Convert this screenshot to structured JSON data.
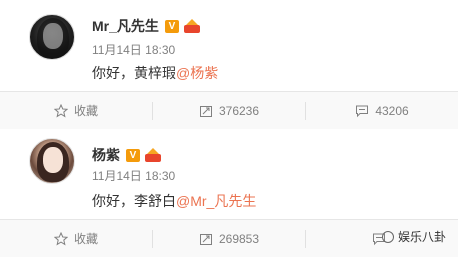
{
  "posts": [
    {
      "username": "Mr_凡先生",
      "verified_badge": "V",
      "time": "11月14日 18:30",
      "content_prefix": "你好，黄梓瑕",
      "mention": "@杨紫",
      "actions": {
        "favorite": "收藏",
        "repost_count": "376236",
        "comment_count": "43206"
      }
    },
    {
      "username": "杨紫",
      "verified_badge": "V",
      "time": "11月14日 18:30",
      "content_prefix": "你好，李舒白",
      "mention": "@Mr_凡先生",
      "actions": {
        "favorite": "收藏",
        "repost_count": "269853",
        "comment_label": ""
      }
    }
  ],
  "watermark": "娱乐八卦",
  "colors": {
    "mention": "#eb7350",
    "verified": "#f49b0b",
    "meta": "#808080"
  },
  "icons": [
    "star-icon",
    "repost-icon",
    "comment-icon",
    "verified-icon",
    "vip-crown-icon"
  ]
}
